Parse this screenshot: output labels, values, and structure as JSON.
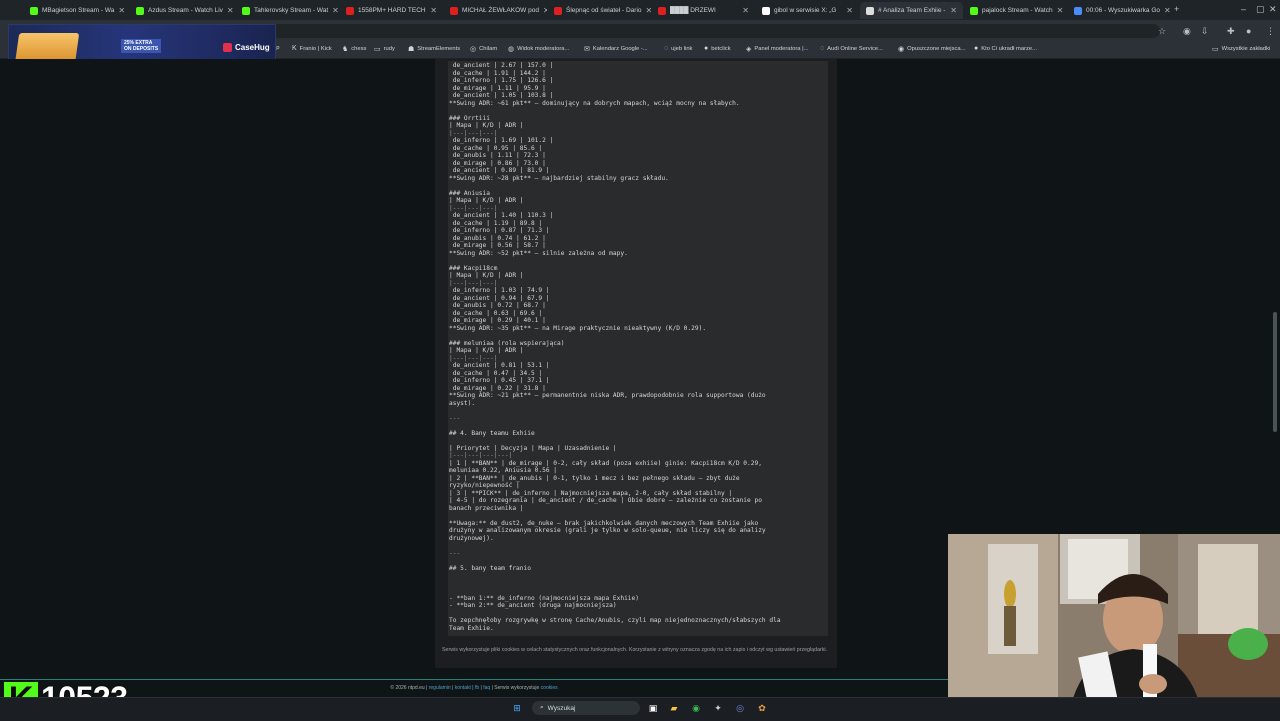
{
  "tabs": [
    {
      "title": "MBagietson Stream - Wa",
      "color": "#53fc18"
    },
    {
      "title": "Azdus Stream - Watch Liv",
      "color": "#53fc18"
    },
    {
      "title": "Tahlerovsky Stream - Wat",
      "color": "#53fc18"
    },
    {
      "title": "1558PM+ HARD TECH",
      "color": "#e02020"
    },
    {
      "title": "MICHAŁ ŻEWŁAKOW pod",
      "color": "#e02020"
    },
    {
      "title": "Ślepnąc od świateł - Dario",
      "color": "#e02020"
    },
    {
      "title": "████ DRZEWI",
      "color": "#e02020"
    },
    {
      "title": "gibol w serwisie X: „G",
      "color": "#ffffff"
    },
    {
      "title": "# Analiza Team Exhiie -",
      "color": "#dddddd"
    },
    {
      "title": "pajalock Stream - Watch",
      "color": "#53fc18"
    },
    {
      "title": "00:06 - Wyszukiwarka Go",
      "color": "#4a8df8"
    }
  ],
  "bookmarks": [
    "op",
    "Franio | Kick",
    "chess",
    "rudy",
    "StreamElements",
    "Chilam",
    "Widok moderatora...",
    "Kalendarz Google -...",
    "ujeb link",
    "betclick",
    "Panel moderatora |...",
    "Audi Online Service...",
    "Opuszczone miejsca...",
    "Kto Ci ukradł marze...",
    "Wszystkie zakładki"
  ],
  "ad": {
    "pill": "25% EXTRA",
    "pill_sub": "ON DEPOSITS",
    "logo": "CaseHug"
  },
  "doc_lines": [
    " de_ancient | 2.67 | 157.0 |",
    " de_cache | 1.91 | 144.2 |",
    " de_inferno | 1.75 | 126.6 |",
    " de_mirage | 1.11 | 95.9 |",
    " de_ancient | 1.05 | 103.8 |",
    "**Swing ADR: ~61 pkt** – dominujący na dobrych mapach, wciąż mocny na słabych.",
    "",
    "### Orrtiii",
    "| Mapa | K/D | ADR |",
    "|---|---|---|",
    " de_inferno | 1.69 | 101.2 |",
    " de_cache | 0.95 | 85.6 |",
    " de_anubis | 1.11 | 72.3 |",
    " de_mirage | 0.86 | 73.0 |",
    " de_ancient | 0.89 | 81.9 |",
    "**Swing ADR: ~28 pkt** – najbardziej stabilny gracz składu.",
    "",
    "### Aniusia",
    "| Mapa | K/D | ADR |",
    "|---|---|---|",
    " de_ancient | 1.40 | 110.3 |",
    " de_cache | 1.19 | 89.8 |",
    " de_inferno | 0.87 | 71.3 |",
    " de_anubis | 0.74 | 61.2 |",
    " de_mirage | 0.56 | 58.7 |",
    "**Swing ADR: ~52 pkt** – silnie zależna od mapy.",
    "",
    "### Kacpi18cm",
    "| Mapa | K/D | ADR |",
    "|---|---|---|",
    " de_inferno | 1.03 | 74.9 |",
    " de_ancient | 0.94 | 67.9 |",
    " de_anubis | 0.72 | 68.7 |",
    " de_cache | 0.63 | 69.6 |",
    " de_mirage | 0.29 | 40.1 |",
    "**Swing ADR: ~35 pkt** – na Mirage praktycznie nieaktywny (K/D 0.29).",
    "",
    "### meluniaa (rola wspierająca)",
    "| Mapa | K/D | ADR |",
    "|---|---|---|",
    " de_ancient | 0.81 | 53.1 |",
    " de_cache | 0.47 | 34.5 |",
    " de_inferno | 0.45 | 37.1 |",
    " de_mirage | 0.22 | 31.8 |",
    "**Swing ADR: ~21 pkt** – permanentnie niska ADR, prawdopodobnie rola supportowa (dużo",
    "asyst).",
    "",
    "---",
    "",
    "## 4. Bany teamu Exhiie",
    "",
    "| Priorytet | Decyzja | Mapa | Uzasadnienie |",
    "|---|---|---|---|",
    "| 1 | **BAN** | de_mirage | 0-2, cały skład (poza exhiie) ginie: Kacpi18cm K/D 0.29,",
    "meluniaa 0.22, Aniusia 0.56 |",
    "| 2 | **BAN** | de_anubis | 0-1, tylko 1 mecz i bez pełnego składu – zbyt duże",
    "ryzyko/niepewność |",
    "| 3 | **PICK** | de_inferno | Najmocniejsza mapa, 2-0, cały skład stabilny |",
    "| 4-5 | do rozegrania | de_ancient / de_cache | Obie dobre – zależnie co zostanie po",
    "banach przeciwnika |",
    "",
    "**Uwaga:** de_dust2, de_nuke – brak jakichkolwiek danych meczowych Team Exhiie jako",
    "drużyny w analizowanym okresie (grali je tylko w solo-queue, nie liczy się do analizy",
    "drużynowej).",
    "",
    "---",
    "",
    "## 5. bany team franio",
    "",
    "",
    "",
    "- **ban 1:** de_inferno (najmocniejsza mapa Exhiie)",
    "- **ban 2:** de_ancient (druga najmocniejsza)",
    "",
    "To zepchnęłoby rozgrywkę w stronę Cache/Anubis, czyli map niejednoznacznych/słabszych dla",
    "Team Exhiie."
  ],
  "cookie_text": "Serwis wykorzystuje pliki cookies w celach statystycznych oraz funkcjonalnych. Korzystanie z witryny oznacza zgodę na ich zapis i odczyt wg ustawień przeglądarki.",
  "footer": {
    "prefix": "© 2026 ntpd.eu |",
    "l1": "regulamin",
    "l2": "kontakt",
    "l3": "fb",
    "l4": "faq",
    "mid": "| Serwis wykorzystuje",
    "l5": "cookies"
  },
  "counter": {
    "value": "10523"
  },
  "taskbar": {
    "search_label": "Wyszukaj"
  }
}
